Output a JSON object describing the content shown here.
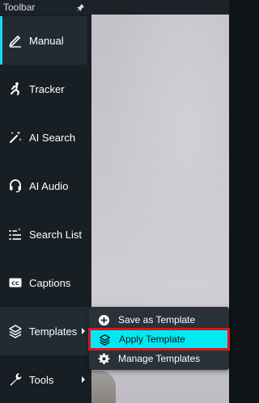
{
  "toolbar": {
    "title": "Toolbar",
    "pin_icon": "pin-icon"
  },
  "sidebar": {
    "items": [
      {
        "label": "Manual",
        "icon": "pencil-icon",
        "active": true
      },
      {
        "label": "Tracker",
        "icon": "running-person-icon"
      },
      {
        "label": "AI Search",
        "icon": "magic-wand-icon"
      },
      {
        "label": "AI Audio",
        "icon": "headset-icon"
      },
      {
        "label": "Search List",
        "icon": "list-search-icon"
      },
      {
        "label": "Captions",
        "icon": "closed-captions-icon"
      },
      {
        "label": "Templates",
        "icon": "layers-icon",
        "open": true,
        "has_submenu": true
      },
      {
        "label": "Tools",
        "icon": "wrench-icon",
        "has_submenu": true
      }
    ]
  },
  "submenu": {
    "items": [
      {
        "label": "Save as Template",
        "icon": "plus-circle-icon"
      },
      {
        "label": "Apply Template",
        "icon": "layers-icon",
        "highlighted": true
      },
      {
        "label": "Manage Templates",
        "icon": "gear-icon"
      }
    ]
  },
  "colors": {
    "accent": "#1ad6e6",
    "highlight": "#00e9f5",
    "highlight_outline": "#e0141c",
    "sidebar_bg": "#171e24"
  }
}
